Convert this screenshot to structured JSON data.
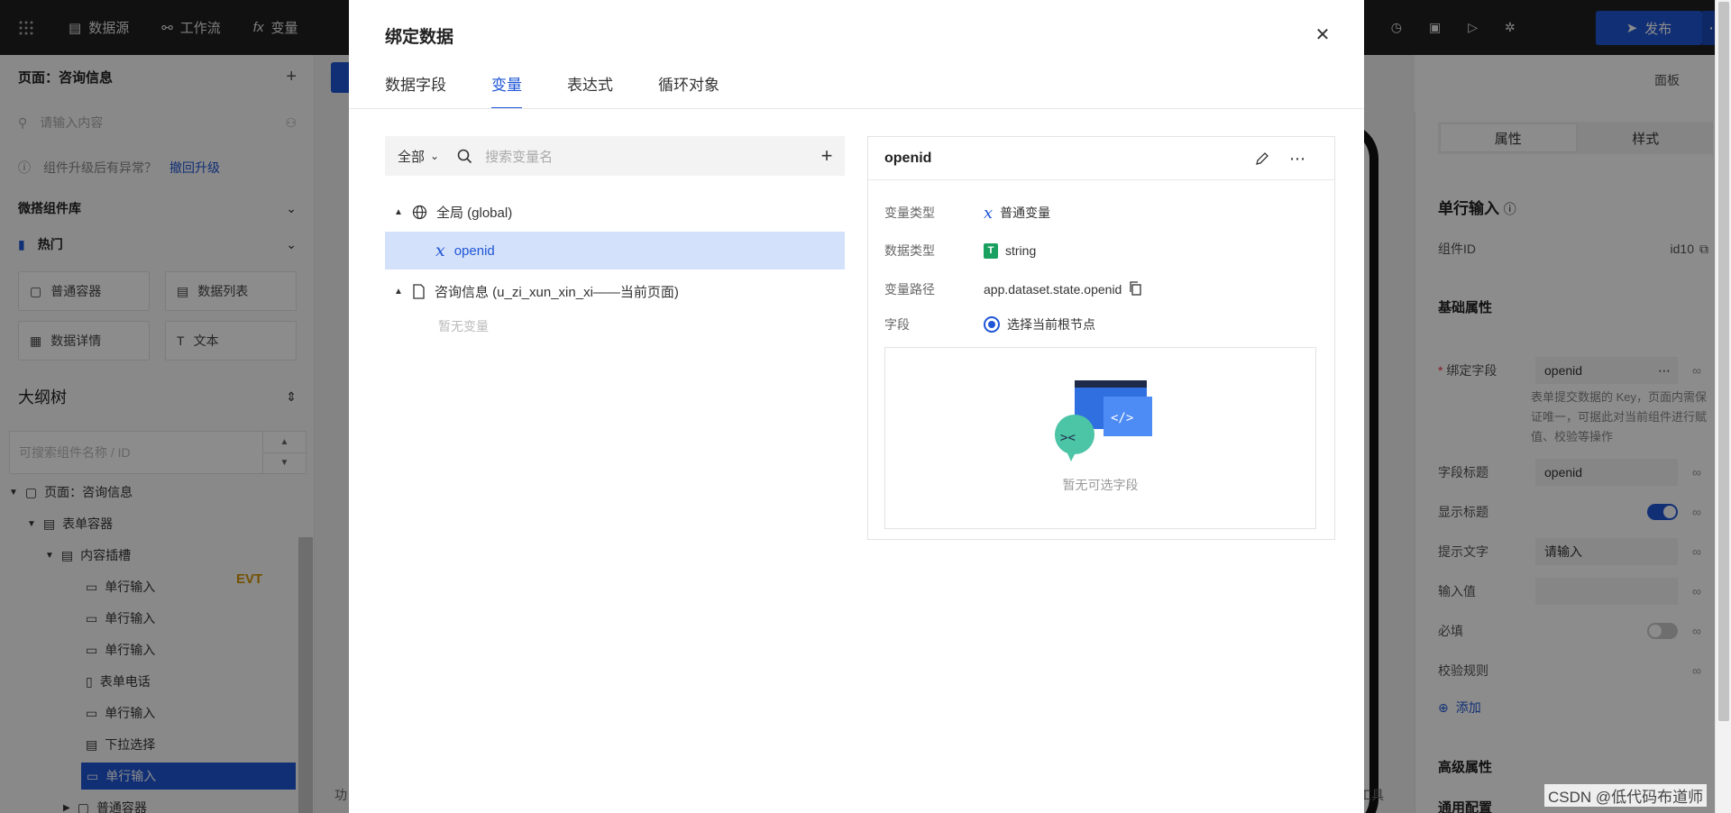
{
  "topbar": {
    "items": [
      {
        "icon": "database-icon",
        "label": "数据源"
      },
      {
        "icon": "workflow-icon",
        "label": "工作流"
      },
      {
        "icon": "function-icon",
        "label": "变量"
      }
    ],
    "publish_label": "发布"
  },
  "left": {
    "page_title": "页面：咨询信息",
    "search_placeholder": "请输入内容",
    "upgrade_text": "组件升级后有异常？",
    "upgrade_link": "撤回升级",
    "lib_title": "微搭组件库",
    "hot_title": "热门",
    "components": [
      "普通容器",
      "数据列表",
      "数据详情",
      "文本"
    ],
    "outline_title": "大纲树",
    "tree_search_placeholder": "可搜索组件名称 / ID",
    "tree": [
      "页面：咨询信息",
      "表单容器",
      "内容插槽",
      "单行输入",
      "单行输入",
      "单行输入",
      "表单电话",
      "单行输入",
      "下拉选择",
      "单行输入",
      "普通容器"
    ],
    "evt_badge": "EVT"
  },
  "canvas": {
    "panel_label": "面板",
    "footer_left": "功",
    "footer_right": "工具"
  },
  "right": {
    "tabs": [
      "属性",
      "样式"
    ],
    "title": "单行输入",
    "component_id_label": "组件ID",
    "component_id_value": "id10",
    "basic_section": "基础属性",
    "bind_field_label": "绑定字段",
    "bind_field_value": "openid",
    "bind_hint": "表单提交数据的 Key，页面内需保证唯一，可据此对当前组件进行赋值、校验等操作",
    "field_title_label": "字段标题",
    "field_title_value": "openid",
    "show_title_label": "显示标题",
    "placeholder_label": "提示文字",
    "placeholder_value": "请输入",
    "input_value_label": "输入值",
    "required_label": "必填",
    "rules_label": "校验规则",
    "add_label": "添加",
    "advanced_section": "高级属性",
    "generic_section": "通用配置"
  },
  "modal": {
    "title": "绑定数据",
    "tabs": [
      "数据字段",
      "变量",
      "表达式",
      "循环对象"
    ],
    "active_tab": 1,
    "filter_label": "全部",
    "search_placeholder": "搜索变量名",
    "tree": {
      "global_label": "全局 (global)",
      "global_var": "openid",
      "page_label": "咨询信息 (u_zi_xun_xin_xi——当前页面)",
      "page_empty": "暂无变量"
    },
    "detail": {
      "name": "openid",
      "var_type_label": "变量类型",
      "var_type_value": "普通变量",
      "data_type_label": "数据类型",
      "data_type_value": "string",
      "path_label": "变量路径",
      "path_value": "app.dataset.state.openid",
      "field_label": "字段",
      "field_option": "选择当前根节点",
      "empty_fields": "暂无可选字段"
    }
  },
  "watermark": "CSDN @低代码布道师"
}
